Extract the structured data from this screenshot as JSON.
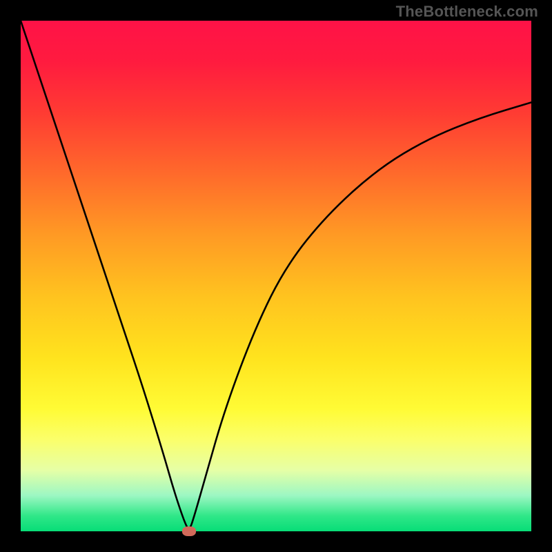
{
  "watermark": "TheBottleneck.com",
  "chart_data": {
    "type": "line",
    "title": "",
    "xlabel": "",
    "ylabel": "",
    "xlim": [
      0,
      100
    ],
    "ylim": [
      0,
      100
    ],
    "grid": false,
    "legend": false,
    "note": "V-shaped bottleneck curve on a vertical red→green gradient; curve reaches zero (optimal) at x≈33 and rises on both sides",
    "nadir_x": 33,
    "series": [
      {
        "name": "bottleneck-curve",
        "x": [
          0,
          4,
          8,
          12,
          16,
          20,
          24,
          28,
          30,
          32,
          33,
          34,
          36,
          40,
          46,
          52,
          60,
          70,
          80,
          90,
          100
        ],
        "values": [
          100,
          88,
          76,
          64,
          52,
          40,
          28,
          15,
          8,
          2,
          0,
          3,
          10,
          24,
          40,
          52,
          62,
          71,
          77,
          81,
          84
        ]
      }
    ],
    "markers": [
      {
        "name": "nadir",
        "x": 33,
        "y": 0,
        "color": "#d06a5a"
      }
    ],
    "background_gradient": {
      "direction": "top-to-bottom",
      "stops": [
        {
          "pos": 0.0,
          "color": "#ff1247"
        },
        {
          "pos": 0.3,
          "color": "#ff6a2b"
        },
        {
          "pos": 0.66,
          "color": "#ffe31e"
        },
        {
          "pos": 0.9,
          "color": "#9cf7c3"
        },
        {
          "pos": 1.0,
          "color": "#07dd77"
        }
      ]
    }
  }
}
